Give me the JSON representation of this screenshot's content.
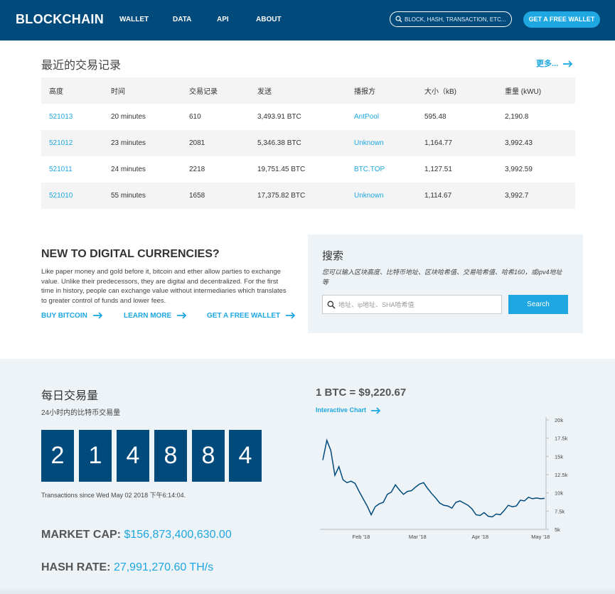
{
  "nav": {
    "logo": "BLOCKCHAIN",
    "links": [
      "WALLET",
      "DATA",
      "API",
      "ABOUT"
    ],
    "search_placeholder": "BLOCK, HASH, TRANSACTION, ETC...",
    "cta": "GET A FREE WALLET"
  },
  "recent": {
    "title": "最近的交易记录",
    "more": "更多...",
    "columns": [
      "高度",
      "时间",
      "交易记录",
      "发送",
      "播报方",
      "大小（kB)",
      "重量 (kWU)"
    ],
    "rows": [
      {
        "height": "521013",
        "time": "20 minutes",
        "txs": "610",
        "sent": "3,493.91 BTC",
        "relayed_by": "AntPool",
        "size": "595.48",
        "weight": "2,190.8"
      },
      {
        "height": "521012",
        "time": "23 minutes",
        "txs": "2081",
        "sent": "5,346.38 BTC",
        "relayed_by": "Unknown",
        "size": "1,164.77",
        "weight": "3,992.43"
      },
      {
        "height": "521011",
        "time": "24 minutes",
        "txs": "2218",
        "sent": "19,751.45 BTC",
        "relayed_by": "BTC.TOP",
        "size": "1,127.51",
        "weight": "3,992.59"
      },
      {
        "height": "521010",
        "time": "55 minutes",
        "txs": "1658",
        "sent": "17,375.82 BTC",
        "relayed_by": "Unknown",
        "size": "1,114.67",
        "weight": "3,992.7"
      }
    ]
  },
  "intro": {
    "title": "NEW TO DIGITAL CURRENCIES?",
    "text": "Like paper money and gold before it, bitcoin and ether allow parties to exchange value. Unlike their predecessors, they are digital and decentralized. For the first time in history, people can exchange value without intermediaries which translates to greater control of funds and lower fees.",
    "links": [
      "BUY BITCOIN",
      "LEARN MORE",
      "GET A FREE WALLET"
    ]
  },
  "search_panel": {
    "title": "搜索",
    "description": "您可以输入区块高度、比特币地址、区块哈希值、交易哈希值、哈希160，或ipv4地址等",
    "placeholder": "地址、ip地址、SHA哈希值",
    "button": "Search"
  },
  "daily": {
    "title": "每日交易量",
    "subtitle": "24小时内的比特币交易量",
    "digits": [
      "2",
      "1",
      "4",
      "8",
      "8",
      "4"
    ],
    "since": "Transactions since Wed May 02 2018 下午6:14:04."
  },
  "market_cap": {
    "label": "MARKET CAP:",
    "value": "$156,873,400,630.00"
  },
  "hash_rate": {
    "label": "HASH RATE:",
    "value": "27,991,270.60 TH/s"
  },
  "price": {
    "label": "1 BTC = $9,220.67",
    "chart_link": "Interactive Chart"
  },
  "colors": {
    "brand_navy": "#004a7c",
    "accent_blue": "#1ea7e0",
    "panel_bg": "#eef3f7"
  },
  "icons": {
    "search": "search-icon",
    "arrow": "arrow-right-icon"
  },
  "chart_data": {
    "type": "line",
    "title": "",
    "xlabel": "",
    "ylabel": "",
    "x_ticks": [
      "Feb '18",
      "Mar '18",
      "Apr '18",
      "May '18"
    ],
    "y_ticks": [
      "5k",
      "7.5k",
      "10k",
      "12.5k",
      "15k",
      "17.5k",
      "20k"
    ],
    "ylim": [
      5000,
      20000
    ],
    "grid": false,
    "series": [
      {
        "x": [
          "2018-01-13",
          "2018-01-15",
          "2018-01-17",
          "2018-01-19",
          "2018-01-21",
          "2018-01-23",
          "2018-01-25",
          "2018-01-27",
          "2018-01-29",
          "2018-01-31",
          "2018-02-02",
          "2018-02-04",
          "2018-02-06",
          "2018-02-08",
          "2018-02-10",
          "2018-02-12",
          "2018-02-14",
          "2018-02-16",
          "2018-02-18",
          "2018-02-20",
          "2018-02-22",
          "2018-02-24",
          "2018-02-26",
          "2018-02-28",
          "2018-03-02",
          "2018-03-04",
          "2018-03-06",
          "2018-03-08",
          "2018-03-10",
          "2018-03-12",
          "2018-03-14",
          "2018-03-16",
          "2018-03-18",
          "2018-03-20",
          "2018-03-22",
          "2018-03-24",
          "2018-03-26",
          "2018-03-28",
          "2018-03-30",
          "2018-04-01",
          "2018-04-03",
          "2018-04-05",
          "2018-04-07",
          "2018-04-09",
          "2018-04-11",
          "2018-04-13",
          "2018-04-15",
          "2018-04-17",
          "2018-04-19",
          "2018-04-21",
          "2018-04-23",
          "2018-04-25",
          "2018-04-27",
          "2018-04-29",
          "2018-05-01",
          "2018-05-03"
        ],
        "values": [
          14500,
          17200,
          15800,
          12400,
          13600,
          11800,
          11400,
          11600,
          11300,
          10200,
          9200,
          8200,
          7000,
          8100,
          8500,
          8700,
          9800,
          10100,
          11100,
          10400,
          9800,
          10200,
          10300,
          10800,
          11200,
          11400,
          10600,
          9900,
          9300,
          8600,
          8300,
          8200,
          7900,
          8700,
          8900,
          8600,
          8300,
          7800,
          7000,
          6900,
          7300,
          6800,
          6700,
          7100,
          7000,
          7600,
          8300,
          8100,
          8200,
          9000,
          8900,
          9400,
          9200,
          9300,
          9200,
          9250
        ]
      }
    ]
  }
}
